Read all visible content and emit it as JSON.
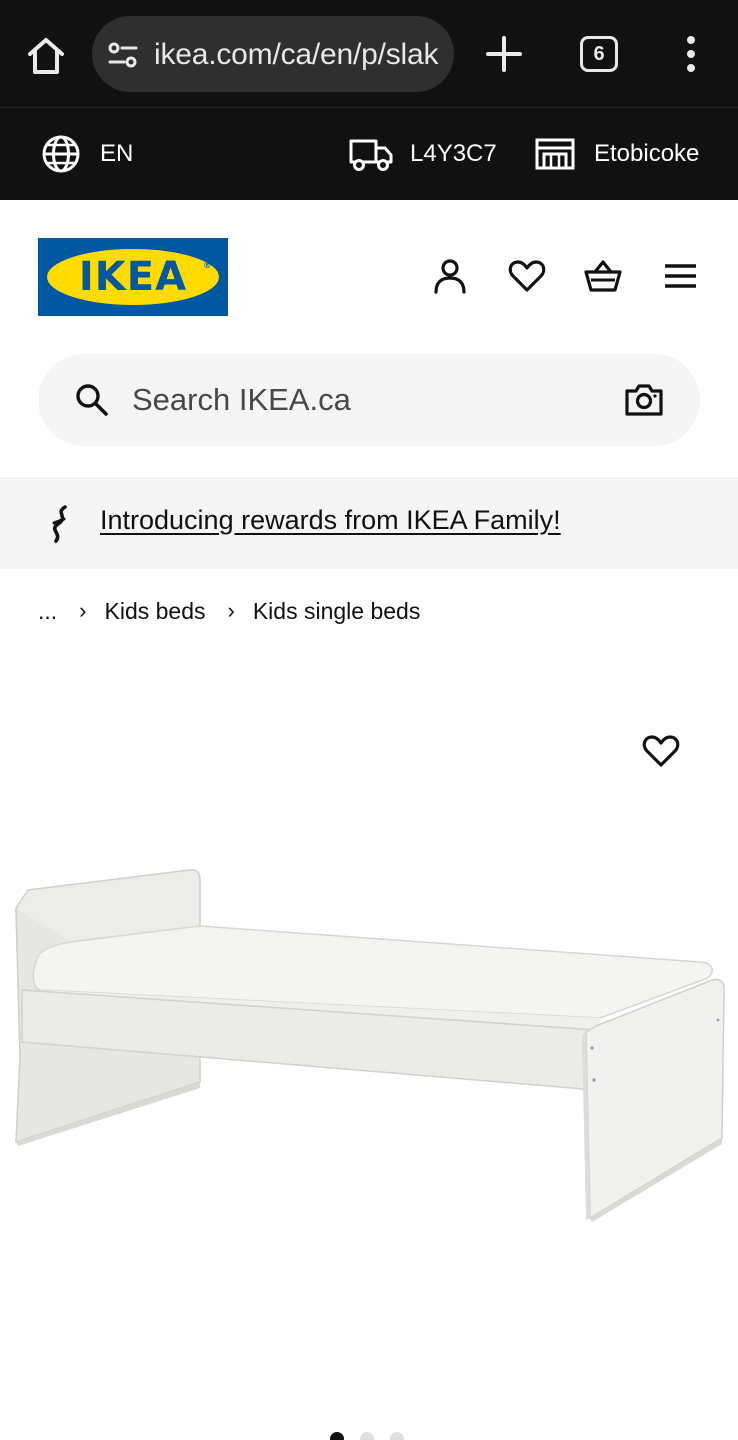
{
  "browser": {
    "url": "ikea.com/ca/en/p/slak",
    "tab_count": "6"
  },
  "utility": {
    "language": "EN",
    "postal_code": "L4Y3C7",
    "store": "Etobicoke"
  },
  "header": {
    "logo_text": "IKEA"
  },
  "search": {
    "placeholder": "Search IKEA.ca"
  },
  "promo": {
    "text": "Introducing rewards from IKEA Family!"
  },
  "breadcrumb": {
    "ellipsis": "...",
    "items": [
      "Kids beds",
      "Kids single beds"
    ]
  },
  "product": {
    "image_count": 3,
    "active_image": 1
  },
  "colors": {
    "chrome_bg": "#111111",
    "ikea_blue": "#0058a3",
    "ikea_yellow": "#ffdb00",
    "surface_grey": "#f5f5f5"
  }
}
